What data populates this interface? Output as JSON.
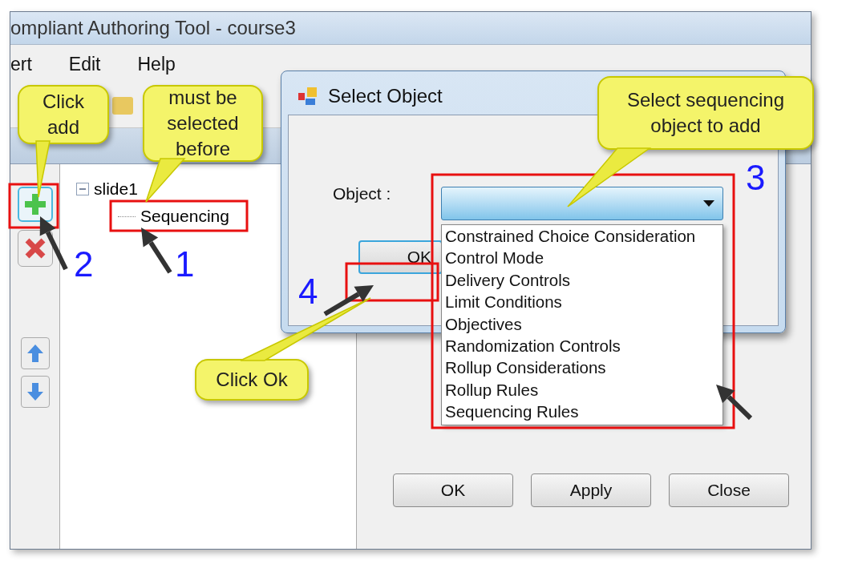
{
  "window": {
    "title": "ompliant Authoring Tool - course3"
  },
  "menu": [
    "ert",
    "Edit",
    "Help"
  ],
  "tree": [
    {
      "label": "slide1",
      "expanded": true,
      "children": [
        {
          "label": "Sequencing"
        }
      ]
    }
  ],
  "dialog": {
    "title": "Select Object",
    "field_label": "Object :",
    "dropdown": {
      "expanded": true,
      "options": [
        "Constrained Choice Consideration",
        "Control Mode",
        "Delivery Controls",
        "Limit Conditions",
        "Objectives",
        "Randomization Controls",
        "Rollup Considerations",
        "Rollup Rules",
        "Sequencing Rules"
      ]
    },
    "ok_button": "OK"
  },
  "buttons": [
    "OK",
    "Apply",
    "Close"
  ],
  "annotations": [
    {
      "kind": "callout",
      "text": "Click add"
    },
    {
      "kind": "callout",
      "text": "must be selected before"
    },
    {
      "kind": "callout",
      "text": "Select sequencing object to add"
    },
    {
      "kind": "callout",
      "text": "Click Ok"
    },
    {
      "kind": "step",
      "text": "1"
    },
    {
      "kind": "step",
      "text": "2"
    },
    {
      "kind": "step",
      "text": "3"
    },
    {
      "kind": "step",
      "text": "4"
    }
  ]
}
